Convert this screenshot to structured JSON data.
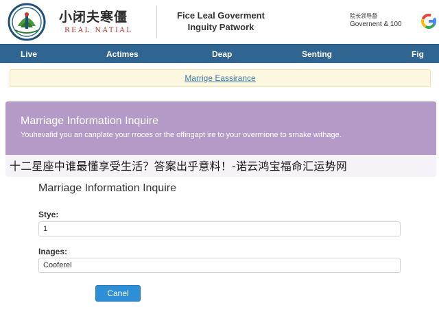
{
  "header": {
    "brand_cn": "小闭夫寒僵",
    "brand_en": "REAL NATIAL",
    "title_line1": "Fice Leal Goverment",
    "title_line2": "Inguity Patwork",
    "gov_cn": "院长领导督",
    "gov_en": "Governent & 100"
  },
  "nav": {
    "items": [
      "Live",
      "Actimes",
      "Deap",
      "Senting",
      "Fig"
    ]
  },
  "alert": {
    "text": "Marrige Eassirance"
  },
  "panel": {
    "title": "Marriage Information Inquire",
    "text": "Youhevafid you an canplate your rroces or the offingapt ire to your overmione to srnake withage."
  },
  "overlay": {
    "text": "十二星座中谁最懂享受生活？答案出乎意料！-诺云鸿宝福命汇运势网"
  },
  "form": {
    "title": "Marriage Information Inquire",
    "style_label": "Stye:",
    "style_value": "1",
    "images_label": "Inages:",
    "images_value": "Cooferel",
    "cancel_label": "Canel"
  },
  "colors": {
    "nav_bg": "#2f6590",
    "panel_bg": "#b49ac6",
    "alert_bg": "#fcf8df",
    "button_bg": "#2e8fd6",
    "brand_red": "#b2342c"
  },
  "icons": {
    "logo": "emblem-logo",
    "browser": "google-icon"
  }
}
